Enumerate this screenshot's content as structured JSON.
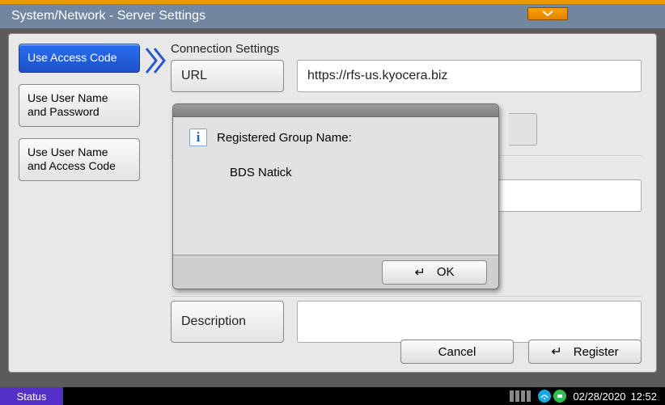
{
  "window": {
    "title": "System/Network - Server Settings"
  },
  "sidebar": {
    "items": [
      {
        "label": "Use Access Code",
        "active": true
      },
      {
        "label": "Use User Name\nand Password",
        "active": false
      },
      {
        "label": "Use User Name\nand Access Code",
        "active": false
      }
    ]
  },
  "connection": {
    "section_title": "Connection Settings",
    "url_label": "URL",
    "url_value": "https://rfs-us.kyocera.biz",
    "desc_label": "Description",
    "desc_value": ""
  },
  "modal": {
    "message_label": "Registered Group Name:",
    "message_value": "BDS Natick",
    "ok_label": "OK",
    "info_glyph": "i"
  },
  "buttons": {
    "cancel": "Cancel",
    "register": "Register",
    "enter_glyph": "↵"
  },
  "status": {
    "label": "Status",
    "date": "02/28/2020",
    "time": "12:52"
  }
}
